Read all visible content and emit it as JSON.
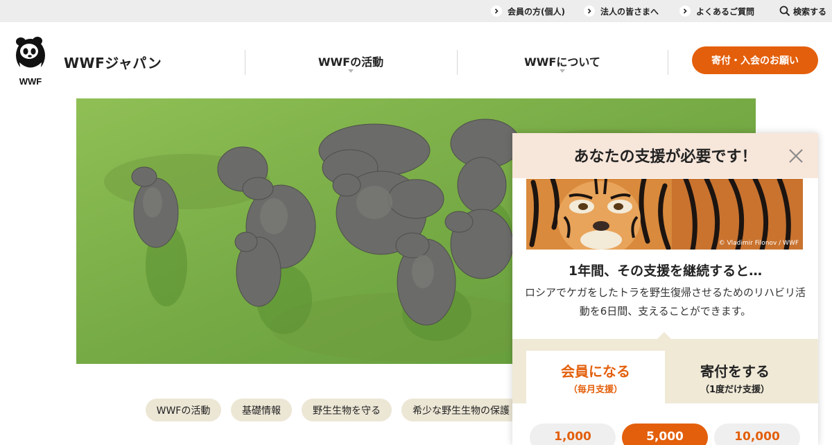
{
  "utility_nav": {
    "members": "会員の方(個人)",
    "corporate": "法人の皆さまへ",
    "faq": "よくあるご質問",
    "search": "検索する"
  },
  "header": {
    "logo_text": "WWF",
    "brand_name": "WWFジャパン",
    "nav": [
      "WWFの活動",
      "WWFについて"
    ],
    "cta_label": "寄付・入会のお願い"
  },
  "hero": {
    "alt": "エリア上空から見たゾウの群れ"
  },
  "tags": [
    "WWFの活動",
    "基礎情報",
    "野生生物を守る",
    "希少な野生生物の保護"
  ],
  "popup": {
    "title": "あなたの支援が必要です！",
    "image_credit": "© Vladimir Filonov / WWF",
    "subtitle": "1年間、その支援を継続すると…",
    "description": "ロシアでケガをしたトラを野生復帰させるためのリハビリ活動を6日間、支えることができます。",
    "tabs": [
      {
        "label": "会員になる",
        "sub": "（毎月支援）",
        "active": true
      },
      {
        "label": "寄付をする",
        "sub": "（1度だけ支援）",
        "active": false
      }
    ],
    "amounts": [
      "1,000",
      "5,000",
      "10,000"
    ],
    "selected_amount": "5,000"
  },
  "colors": {
    "accent": "#e35f0b",
    "utility_bar": "#ededed",
    "tag_bg": "#ece6d5",
    "popup_head": "#f7e6da",
    "tab_zone": "#efe9d6"
  }
}
